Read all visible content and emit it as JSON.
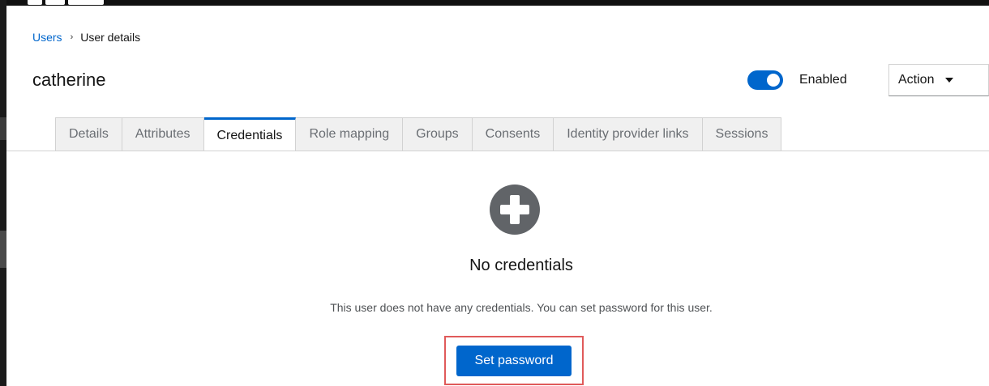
{
  "breadcrumb": {
    "parent": "Users",
    "separator": "›",
    "current": "User details"
  },
  "page": {
    "title": "catherine"
  },
  "header": {
    "enabled_label": "Enabled",
    "enabled": true,
    "action_label": "Action"
  },
  "tabs": [
    {
      "label": "Details",
      "active": false
    },
    {
      "label": "Attributes",
      "active": false
    },
    {
      "label": "Credentials",
      "active": true
    },
    {
      "label": "Role mapping",
      "active": false
    },
    {
      "label": "Groups",
      "active": false
    },
    {
      "label": "Consents",
      "active": false
    },
    {
      "label": "Identity provider links",
      "active": false
    },
    {
      "label": "Sessions",
      "active": false
    }
  ],
  "empty_state": {
    "icon": "plus-circle-icon",
    "title": "No credentials",
    "body": "This user does not have any credentials. You can set password for this user.",
    "button_label": "Set password"
  },
  "colors": {
    "primary": "#0066cc",
    "highlight": "#e05a5a",
    "text": "#151515"
  }
}
